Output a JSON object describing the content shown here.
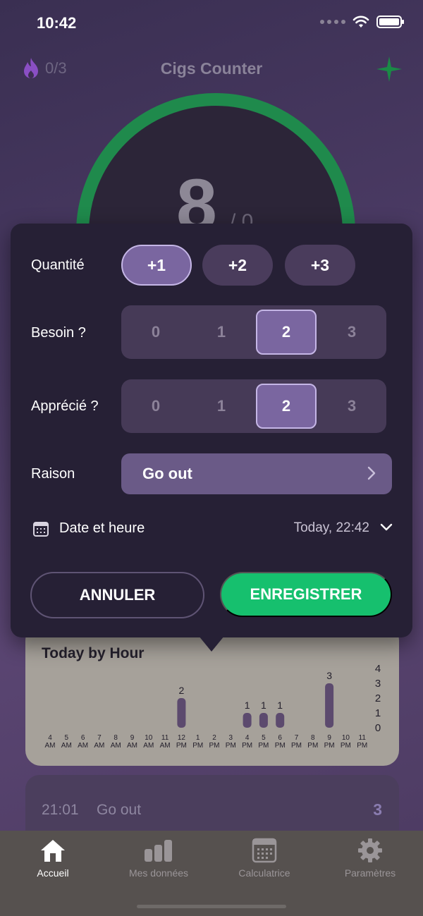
{
  "status_bar": {
    "time": "10:42"
  },
  "header": {
    "streak": "0/3",
    "title": "Cigs Counter"
  },
  "gauge": {
    "count": "8",
    "sub": "/ 0"
  },
  "form": {
    "quantity_label": "Quantité",
    "quantity_options": [
      "+1",
      "+2",
      "+3"
    ],
    "quantity_selected": "+1",
    "need_label": "Besoin ?",
    "need_options": [
      "0",
      "1",
      "2",
      "3"
    ],
    "need_selected": "2",
    "liked_label": "Apprécié ?",
    "liked_options": [
      "0",
      "1",
      "2",
      "3"
    ],
    "liked_selected": "2",
    "reason_label": "Raison",
    "reason_value": "Go out",
    "date_label": "Date et heure",
    "date_value": "Today, 22:42",
    "cancel_label": "ANNULER",
    "save_label": "ENREGISTRER"
  },
  "chart_data": {
    "type": "bar",
    "title": "Today by Hour",
    "categories": [
      {
        "hour": "4",
        "period": "AM"
      },
      {
        "hour": "5",
        "period": "AM"
      },
      {
        "hour": "6",
        "period": "AM"
      },
      {
        "hour": "7",
        "period": "AM"
      },
      {
        "hour": "8",
        "period": "AM"
      },
      {
        "hour": "9",
        "period": "AM"
      },
      {
        "hour": "10",
        "period": "AM"
      },
      {
        "hour": "11",
        "period": "AM"
      },
      {
        "hour": "12",
        "period": "PM"
      },
      {
        "hour": "1",
        "period": "PM"
      },
      {
        "hour": "2",
        "period": "PM"
      },
      {
        "hour": "3",
        "period": "PM"
      },
      {
        "hour": "4",
        "period": "PM"
      },
      {
        "hour": "5",
        "period": "PM"
      },
      {
        "hour": "6",
        "period": "PM"
      },
      {
        "hour": "7",
        "period": "PM"
      },
      {
        "hour": "8",
        "period": "PM"
      },
      {
        "hour": "9",
        "period": "PM"
      },
      {
        "hour": "10",
        "period": "PM"
      },
      {
        "hour": "11",
        "period": "PM"
      }
    ],
    "values": [
      0,
      0,
      0,
      0,
      0,
      0,
      0,
      0,
      2,
      0,
      0,
      0,
      1,
      1,
      1,
      0,
      0,
      3,
      0,
      0
    ],
    "yticks": [
      "4",
      "3",
      "2",
      "1",
      "0"
    ],
    "ylim": [
      0,
      4
    ],
    "bar_color": "#5c4a6e",
    "grid": false
  },
  "entry": {
    "time": "21:01",
    "reason": "Go out",
    "count": "3"
  },
  "tabbar": {
    "items": [
      {
        "label": "Accueil",
        "icon": "home-icon",
        "active": true
      },
      {
        "label": "Mes données",
        "icon": "bar-chart-icon",
        "active": false
      },
      {
        "label": "Calculatrice",
        "icon": "calculator-icon",
        "active": false
      },
      {
        "label": "Paramètres",
        "icon": "gear-icon",
        "active": false
      }
    ]
  },
  "colors": {
    "accent_green": "#16c06e",
    "selected_purple": "#7a66a0"
  }
}
